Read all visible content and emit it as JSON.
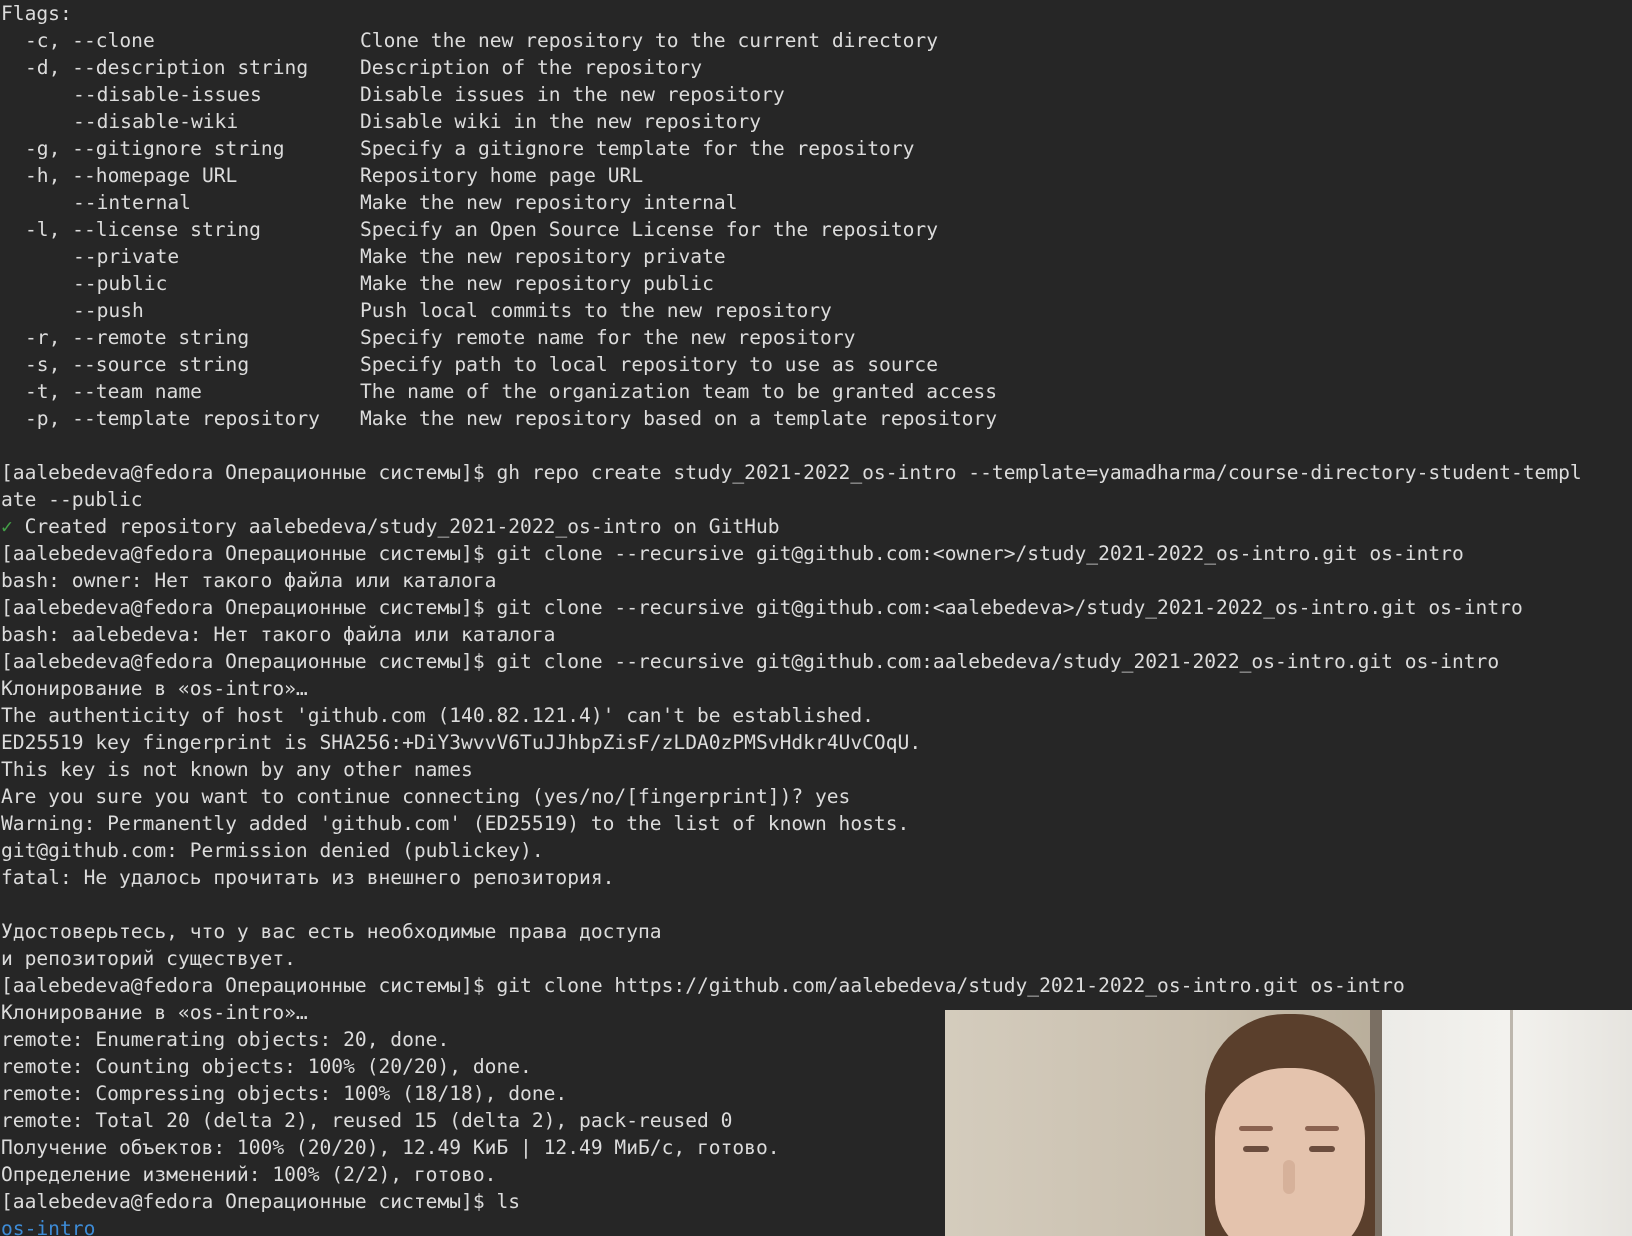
{
  "flags_header": "Flags:",
  "flags": [
    {
      "name": "-c, --clone",
      "long_only": false,
      "desc": "Clone the new repository to the current directory"
    },
    {
      "name": "-d, --description string",
      "long_only": false,
      "desc": "Description of the repository"
    },
    {
      "name": "--disable-issues",
      "long_only": true,
      "desc": "Disable issues in the new repository"
    },
    {
      "name": "--disable-wiki",
      "long_only": true,
      "desc": "Disable wiki in the new repository"
    },
    {
      "name": "-g, --gitignore string",
      "long_only": false,
      "desc": "Specify a gitignore template for the repository"
    },
    {
      "name": "-h, --homepage URL",
      "long_only": false,
      "desc": "Repository home page URL"
    },
    {
      "name": "--internal",
      "long_only": true,
      "desc": "Make the new repository internal"
    },
    {
      "name": "-l, --license string",
      "long_only": false,
      "desc": "Specify an Open Source License for the repository"
    },
    {
      "name": "--private",
      "long_only": true,
      "desc": "Make the new repository private"
    },
    {
      "name": "--public",
      "long_only": true,
      "desc": "Make the new repository public"
    },
    {
      "name": "--push",
      "long_only": true,
      "desc": "Push local commits to the new repository"
    },
    {
      "name": "-r, --remote string",
      "long_only": false,
      "desc": "Specify remote name for the new repository"
    },
    {
      "name": "-s, --source string",
      "long_only": false,
      "desc": "Specify path to local repository to use as source"
    },
    {
      "name": "-t, --team name",
      "long_only": false,
      "desc": "The name of the organization team to be granted access"
    },
    {
      "name": "-p, --template repository",
      "long_only": false,
      "desc": "Make the new repository based on a template repository"
    }
  ],
  "session": {
    "l01": "[aalebedeva@fedora Операционные системы]$ gh repo create study_2021-2022_os-intro --template=yamadharma/course-directory-student-templ",
    "l02": "ate --public",
    "l03_check": "✓",
    "l03": " Created repository aalebedeva/study_2021-2022_os-intro on GitHub",
    "l04": "[aalebedeva@fedora Операционные системы]$ git clone --recursive git@github.com:<owner>/study_2021-2022_os-intro.git os-intro",
    "l05": "bash: owner: Нет такого файла или каталога",
    "l06": "[aalebedeva@fedora Операционные системы]$ git clone --recursive git@github.com:<aalebedeva>/study_2021-2022_os-intro.git os-intro",
    "l07": "bash: aalebedeva: Нет такого файла или каталога",
    "l08": "[aalebedeva@fedora Операционные системы]$ git clone --recursive git@github.com:aalebedeva/study_2021-2022_os-intro.git os-intro",
    "l09": "Клонирование в «os-intro»…",
    "l10": "The authenticity of host 'github.com (140.82.121.4)' can't be established.",
    "l11": "ED25519 key fingerprint is SHA256:+DiY3wvvV6TuJJhbpZisF/zLDA0zPMSvHdkr4UvCOqU.",
    "l12": "This key is not known by any other names",
    "l13": "Are you sure you want to continue connecting (yes/no/[fingerprint])? yes",
    "l14": "Warning: Permanently added 'github.com' (ED25519) to the list of known hosts.",
    "l15": "git@github.com: Permission denied (publickey).",
    "l16": "fatal: Не удалось прочитать из внешнего репозитория.",
    "l17": "",
    "l18": "Удостоверьтесь, что у вас есть необходимые права доступа",
    "l19": "и репозиторий существует.",
    "l20": "[aalebedeva@fedora Операционные системы]$ git clone https://github.com/aalebedeva/study_2021-2022_os-intro.git os-intro",
    "l21": "Клонирование в «os-intro»…",
    "l22": "remote: Enumerating objects: 20, done.",
    "l23": "remote: Counting objects: 100% (20/20), done.",
    "l24": "remote: Compressing objects: 100% (18/18), done.",
    "l25": "remote: Total 20 (delta 2), reused 15 (delta 2), pack-reused 0",
    "l26": "Получение объектов: 100% (20/20), 12.49 КиБ | 12.49 МиБ/с, готово.",
    "l27": "Определение изменений: 100% (2/2), готово.",
    "l28": "[aalebedeva@fedora Операционные системы]$ ls",
    "l29": "os-intro"
  },
  "colors": {
    "background": "#262626",
    "foreground": "#dcdcdc",
    "success_check": "#43a047",
    "directory": "#3d8bd6"
  }
}
